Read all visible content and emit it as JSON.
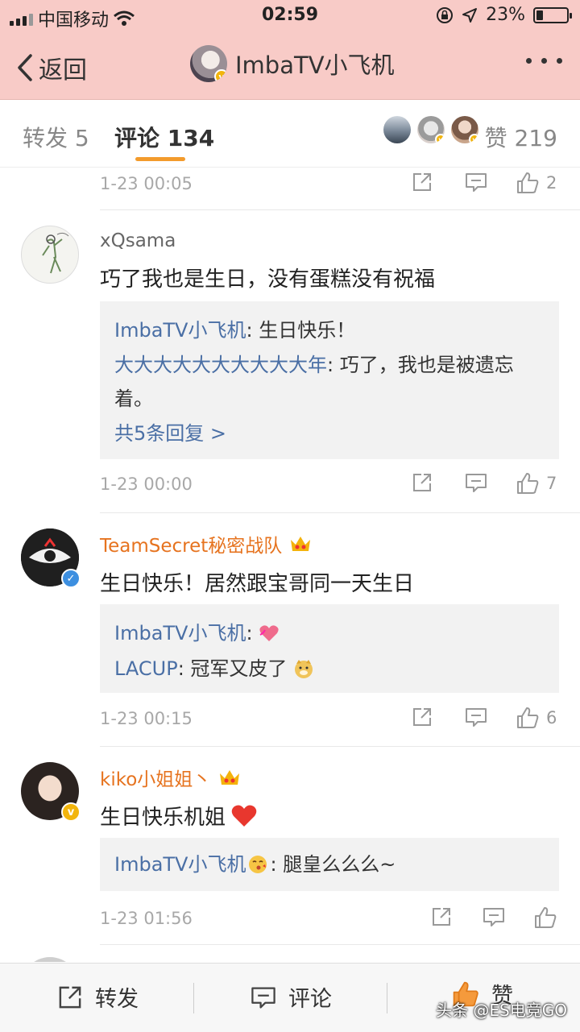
{
  "status": {
    "carrier": "中国移动",
    "time": "02:59",
    "battery": "23%",
    "battery_level": 0.23
  },
  "nav": {
    "back_label": "返回",
    "title": "ImbaTV小飞机"
  },
  "tabs": {
    "repost_label": "转发",
    "repost_count": "5",
    "comment_label": "评论",
    "comment_count": "134",
    "like_label": "赞",
    "like_count": "219"
  },
  "top_row": {
    "time": "1-23 00:05",
    "likes": "2"
  },
  "comments": [
    {
      "user": "xQsama",
      "text": "巧了我也是生日，没有蛋糕没有祝福",
      "replies": [
        {
          "name": "ImbaTV小飞机",
          "text": ": 生日快乐！"
        },
        {
          "name": "大大大大大大大大大大年",
          "text": ": 巧了，我也是被遗忘着。"
        }
      ],
      "more_replies": "共5条回复 >",
      "time": "1-23 00:00",
      "likes": "7"
    },
    {
      "user": "TeamSecret秘密战队",
      "text": "生日快乐！居然跟宝哥同一天生日",
      "replies": [
        {
          "name": "ImbaTV小飞机",
          "text": ": "
        },
        {
          "name": "LACUP",
          "text": ": 冠军又皮了"
        }
      ],
      "time": "1-23 00:15",
      "likes": "6"
    },
    {
      "user": "kiko小姐姐丶",
      "text": "生日快乐机姐",
      "replies": [
        {
          "name": "ImbaTV小飞机",
          "text": ": 腿皇么么么~"
        }
      ],
      "time": "1-23 01:56",
      "likes": ""
    }
  ],
  "bottom": {
    "repost": "转发",
    "comment": "评论",
    "like": "赞"
  },
  "watermark": "头条 @ES电竞GO",
  "colors": {
    "header_bg": "#f8cbc7",
    "accent": "#f39b2c",
    "link": "#4a6fa5",
    "vip_name": "#e6731f"
  }
}
